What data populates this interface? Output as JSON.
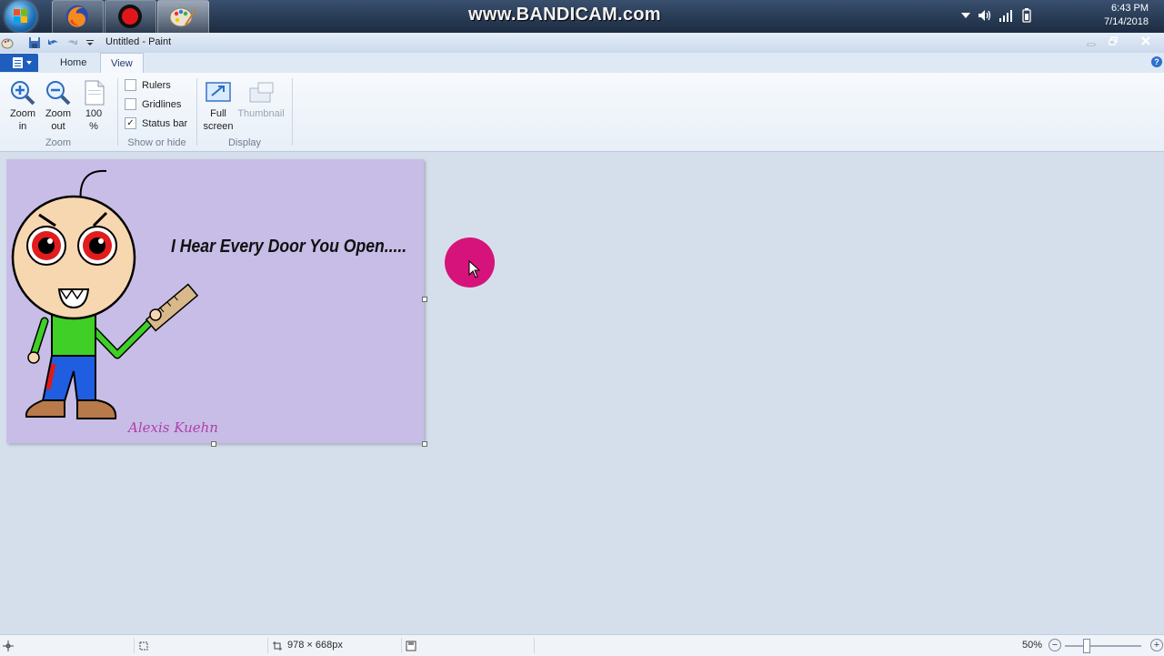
{
  "taskbar": {
    "watermark": "www.BANDICAM.com",
    "apps": [
      "firefox-icon",
      "bandicam-record-icon",
      "paint-icon"
    ],
    "tray_icons": [
      "show-hidden-icons-chevron",
      "speaker-icon",
      "network-signal-icon",
      "battery-icon"
    ],
    "time": "6:43 PM",
    "date": "7/14/2018"
  },
  "window": {
    "title": "Untitled - Paint",
    "quick_access": [
      "paint-small-icon",
      "save-icon",
      "undo-icon",
      "redo-icon",
      "customize-qat-chevron-icon"
    ],
    "controls": [
      "minimize",
      "restore",
      "close"
    ]
  },
  "ribbon": {
    "menu_icon": "paint-menu-icon",
    "tabs": [
      {
        "label": "Home",
        "active": false
      },
      {
        "label": "View",
        "active": true
      }
    ],
    "groups": {
      "zoom": {
        "label": "Zoom",
        "zoom_in_line1": "Zoom",
        "zoom_in_line2": "in",
        "zoom_out_line1": "Zoom",
        "zoom_out_line2": "out",
        "hundred_line1": "100",
        "hundred_line2": "%"
      },
      "show_hide": {
        "label": "Show or hide",
        "rulers": {
          "label": "Rulers",
          "checked": false
        },
        "gridlines": {
          "label": "Gridlines",
          "checked": false
        },
        "status_bar": {
          "label": "Status bar",
          "checked": true
        }
      },
      "display": {
        "label": "Display",
        "full_screen_line1": "Full",
        "full_screen_line2": "screen",
        "thumbnail": "Thumbnail"
      }
    }
  },
  "canvas": {
    "background_color": "#c7bde6",
    "caption": "I Hear Every Door You Open.....",
    "signature": "Alexis Kuehn",
    "drawing": "baldi-character-illustration"
  },
  "status_bar": {
    "image_size": "978 × 668px",
    "zoom_level": "50%"
  },
  "colors": {
    "accent": "#1e5ebc",
    "click_indicator": "#d6137a",
    "workspace": "#d5dfeb"
  }
}
